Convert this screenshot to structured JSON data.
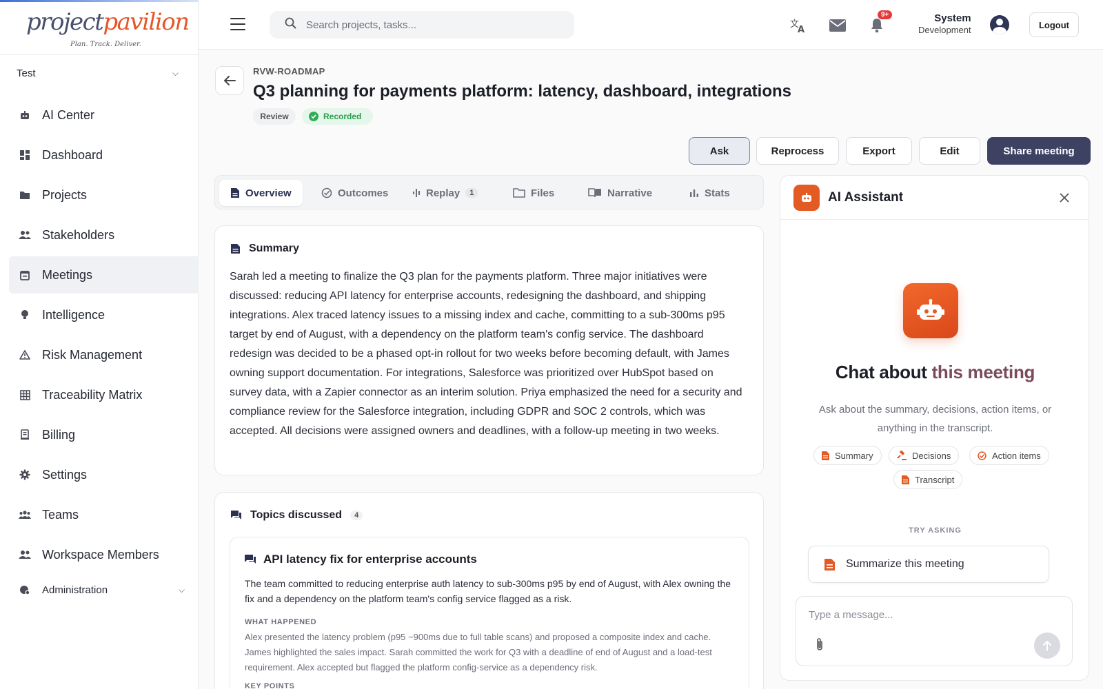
{
  "brand": {
    "name_part1": "project",
    "name_part2": "pavilion",
    "tagline": "Plan. Track. Deliver."
  },
  "workspace": {
    "selected": "Test"
  },
  "sidebar": {
    "items": [
      {
        "label": "AI Center",
        "icon": "robot-icon"
      },
      {
        "label": "Dashboard",
        "icon": "dashboard-icon"
      },
      {
        "label": "Projects",
        "icon": "folder-icon"
      },
      {
        "label": "Stakeholders",
        "icon": "people-icon"
      },
      {
        "label": "Meetings",
        "icon": "calendar-icon",
        "active": true
      },
      {
        "label": "Intelligence",
        "icon": "lightbulb-icon"
      },
      {
        "label": "Risk Management",
        "icon": "warning-icon"
      },
      {
        "label": "Traceability Matrix",
        "icon": "grid-icon"
      },
      {
        "label": "Billing",
        "icon": "receipt-icon"
      },
      {
        "label": "Settings",
        "icon": "gear-icon"
      },
      {
        "label": "Teams",
        "icon": "team-icon"
      },
      {
        "label": "Workspace Members",
        "icon": "people-icon"
      }
    ],
    "admin": {
      "label": "Administration",
      "icon": "admin-icon"
    }
  },
  "topbar": {
    "search_placeholder": "Search projects, tasks...",
    "notification_badge": "9+",
    "user_name": "System",
    "user_role": "Development",
    "logout_label": "Logout"
  },
  "meeting": {
    "code": "RVW-ROADMAP",
    "title": "Q3 planning for payments platform: latency, dashboard, integrations",
    "type_pill": "Review",
    "status_pill": "Recorded"
  },
  "actions": {
    "ask": "Ask",
    "reprocess": "Reprocess",
    "export": "Export",
    "edit": "Edit",
    "share": "Share meeting"
  },
  "tabs": [
    {
      "label": "Overview",
      "active": true
    },
    {
      "label": "Outcomes"
    },
    {
      "label": "Replay",
      "count": "1"
    },
    {
      "label": "Files"
    },
    {
      "label": "Narrative"
    },
    {
      "label": "Stats"
    }
  ],
  "summary": {
    "heading": "Summary",
    "text": "Sarah led a meeting to finalize the Q3 plan for the payments platform. Three major initiatives were discussed: reducing API latency for enterprise accounts, redesigning the dashboard, and shipping integrations. Alex traced latency issues to a missing index and cache, committing to a sub-300ms p95 target by end of August, with a dependency on the platform team's config service. The dashboard redesign was decided to be a phased opt-in rollout for two weeks before becoming default, with James owning support documentation. For integrations, Salesforce was prioritized over HubSpot based on survey data, with a Zapier connector as an interim solution. Priya emphasized the need for a security and compliance review for the Salesforce integration, including GDPR and SOC 2 controls, which was accepted. All decisions were assigned owners and deadlines, with a follow-up meeting in two weeks."
  },
  "topics": {
    "heading": "Topics discussed",
    "count": "4",
    "first": {
      "title": "API latency fix for enterprise accounts",
      "description": "The team committed to reducing enterprise auth latency to sub-300ms p95 by end of August, with Alex owning the fix and a dependency on the platform team's config service flagged as a risk.",
      "what_happened_label": "WHAT HAPPENED",
      "what_happened": "Alex presented the latency problem (p95 ~900ms due to full table scans) and proposed a composite index and cache. James highlighted the sales impact. Sarah committed the work for Q3 with a deadline of end of August and a load-test requirement. Alex accepted but flagged the platform config-service as a dependency risk.",
      "key_points_label": "KEY POINTS"
    }
  },
  "assistant": {
    "title": "AI Assistant",
    "headline_pre": "Chat about ",
    "headline_hl": "this meeting",
    "subtitle": "Ask about the summary, decisions, action items, or anything in the transcript.",
    "chips": [
      "Summary",
      "Decisions",
      "Action items",
      "Transcript"
    ],
    "try_label": "TRY ASKING",
    "suggestion": "Summarize this meeting",
    "input_placeholder": "Type a message..."
  }
}
